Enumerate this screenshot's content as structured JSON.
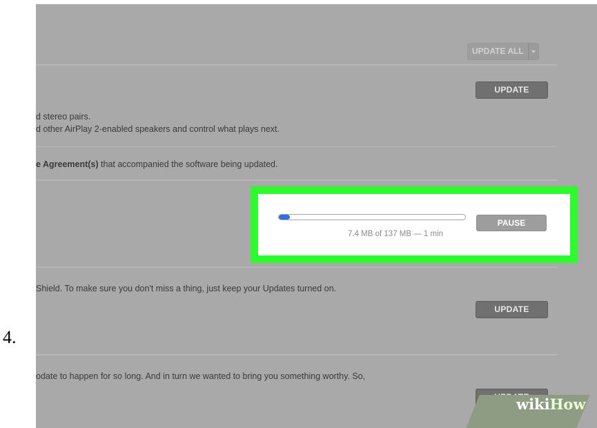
{
  "step_number": "4.",
  "toolbar": {
    "update_all_label": "UPDATE ALL"
  },
  "updates": [
    {
      "update_label": "UPDATE",
      "lines": [
        "d stereo pairs.",
        "d other AirPlay 2-enabled speakers and control what plays next."
      ],
      "agreement_bold": "e Agreement(s)",
      "agreement_rest": " that accompanied the software being updated."
    },
    {
      "progress": {
        "fraction": 0.054,
        "label": "7.4 MB of 137 MB — 1 min"
      },
      "pause_label": "PAUSE"
    },
    {
      "update_label": "UPDATE",
      "line": "Shield. To make sure you don't miss a thing, just keep your Updates turned on."
    },
    {
      "update_label": "UPDATE",
      "line": "odate to happen for so long. And in turn we wanted to bring you something worthy. So,"
    }
  ],
  "watermark": {
    "wiki": "wiki",
    "how": "How"
  },
  "colors": {
    "highlight": "#2dfb2d",
    "progress_fill": "#2f6fe0",
    "screen_bg": "#a9a9a9"
  }
}
